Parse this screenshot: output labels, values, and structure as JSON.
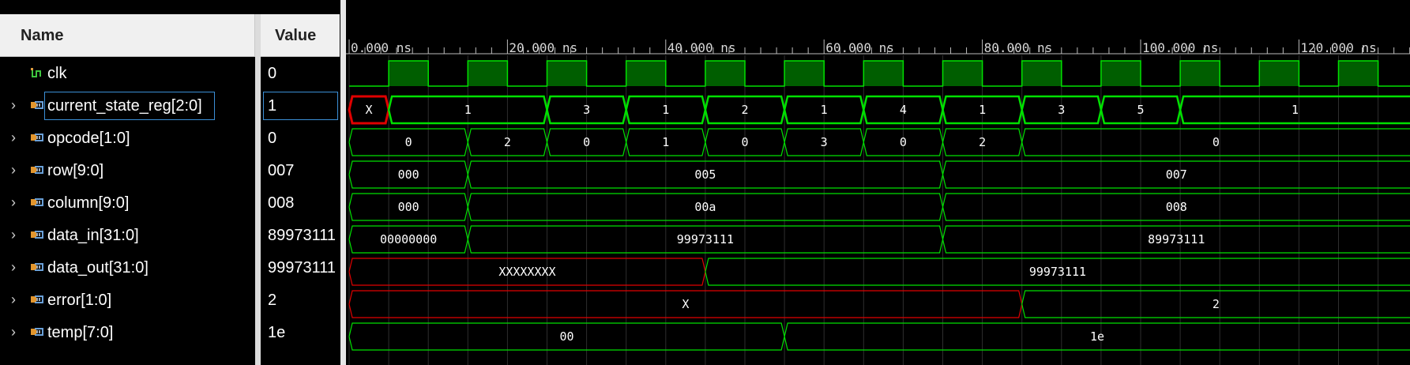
{
  "headers": {
    "name": "Name",
    "value": "Value"
  },
  "colors": {
    "signal_green": "#00e000",
    "clock_fill": "#005e00",
    "error_red": "#e00000",
    "selection_blue": "#3b8fd6"
  },
  "signals": [
    {
      "name": "clk",
      "value": "0",
      "icon": "wire-icon",
      "expandable": false,
      "kind": "clock"
    },
    {
      "name": "current_state_reg[2:0]",
      "value": "1",
      "icon": "bus-icon",
      "expandable": true,
      "kind": "bus",
      "selected": true
    },
    {
      "name": "opcode[1:0]",
      "value": "0",
      "icon": "bus-icon",
      "expandable": true,
      "kind": "bus"
    },
    {
      "name": "row[9:0]",
      "value": "007",
      "icon": "bus-icon",
      "expandable": true,
      "kind": "bus"
    },
    {
      "name": "column[9:0]",
      "value": "008",
      "icon": "bus-icon",
      "expandable": true,
      "kind": "bus"
    },
    {
      "name": "data_in[31:0]",
      "value": "89973111",
      "icon": "bus-icon",
      "expandable": true,
      "kind": "bus"
    },
    {
      "name": "data_out[31:0]",
      "value": "99973111",
      "icon": "bus-icon",
      "expandable": true,
      "kind": "bus"
    },
    {
      "name": "error[1:0]",
      "value": "2",
      "icon": "bus-icon",
      "expandable": true,
      "kind": "bus"
    },
    {
      "name": "temp[7:0]",
      "value": "1e",
      "icon": "bus-icon",
      "expandable": true,
      "kind": "bus"
    }
  ],
  "timeline": {
    "unit": "ns",
    "labels": [
      {
        "t": 0,
        "text": "0.000 ns"
      },
      {
        "t": 20,
        "text": "20.000 ns"
      },
      {
        "t": 40,
        "text": "40.000 ns"
      },
      {
        "t": 60,
        "text": "60.000 ns"
      },
      {
        "t": 80,
        "text": "80.000 ns"
      },
      {
        "t": 100,
        "text": "100.000 ns"
      },
      {
        "t": 120,
        "text": "120.000 ns"
      }
    ],
    "clock_period_ns": 10,
    "first_rise_ns": 5
  },
  "waves": [
    {
      "segments": []
    },
    {
      "segments": [
        {
          "start": 0,
          "end": 5,
          "text": "X",
          "error": true,
          "highlight": true
        },
        {
          "start": 5,
          "end": 25,
          "text": "1"
        },
        {
          "start": 25,
          "end": 35,
          "text": "3"
        },
        {
          "start": 35,
          "end": 45,
          "text": "1"
        },
        {
          "start": 45,
          "end": 55,
          "text": "2"
        },
        {
          "start": 55,
          "end": 65,
          "text": "1"
        },
        {
          "start": 65,
          "end": 75,
          "text": "4"
        },
        {
          "start": 75,
          "end": 85,
          "text": "1"
        },
        {
          "start": 85,
          "end": 95,
          "text": "3"
        },
        {
          "start": 95,
          "end": 105,
          "text": "5"
        },
        {
          "start": 105,
          "end": 150,
          "text": "1"
        }
      ]
    },
    {
      "segments": [
        {
          "start": 0,
          "end": 15,
          "text": "0"
        },
        {
          "start": 15,
          "end": 25,
          "text": "2"
        },
        {
          "start": 25,
          "end": 35,
          "text": "0"
        },
        {
          "start": 35,
          "end": 45,
          "text": "1"
        },
        {
          "start": 45,
          "end": 55,
          "text": "0"
        },
        {
          "start": 55,
          "end": 65,
          "text": "3"
        },
        {
          "start": 65,
          "end": 75,
          "text": "0"
        },
        {
          "start": 75,
          "end": 85,
          "text": "2"
        },
        {
          "start": 85,
          "end": 150,
          "text": "0"
        }
      ]
    },
    {
      "segments": [
        {
          "start": 0,
          "end": 15,
          "text": "000"
        },
        {
          "start": 15,
          "end": 75,
          "text": "005"
        },
        {
          "start": 75,
          "end": 150,
          "text": "007"
        }
      ]
    },
    {
      "segments": [
        {
          "start": 0,
          "end": 15,
          "text": "000"
        },
        {
          "start": 15,
          "end": 75,
          "text": "00a"
        },
        {
          "start": 75,
          "end": 150,
          "text": "008"
        }
      ]
    },
    {
      "segments": [
        {
          "start": 0,
          "end": 15,
          "text": "00000000"
        },
        {
          "start": 15,
          "end": 75,
          "text": "99973111"
        },
        {
          "start": 75,
          "end": 150,
          "text": "89973111"
        }
      ]
    },
    {
      "segments": [
        {
          "start": 0,
          "end": 45,
          "text": "XXXXXXXX",
          "error": true
        },
        {
          "start": 45,
          "end": 150,
          "text": "99973111"
        }
      ]
    },
    {
      "segments": [
        {
          "start": 0,
          "end": 85,
          "text": "X",
          "error": true
        },
        {
          "start": 85,
          "end": 150,
          "text": "2"
        }
      ]
    },
    {
      "segments": [
        {
          "start": 0,
          "end": 55,
          "text": "00"
        },
        {
          "start": 55,
          "end": 150,
          "text": "1e"
        }
      ]
    }
  ]
}
